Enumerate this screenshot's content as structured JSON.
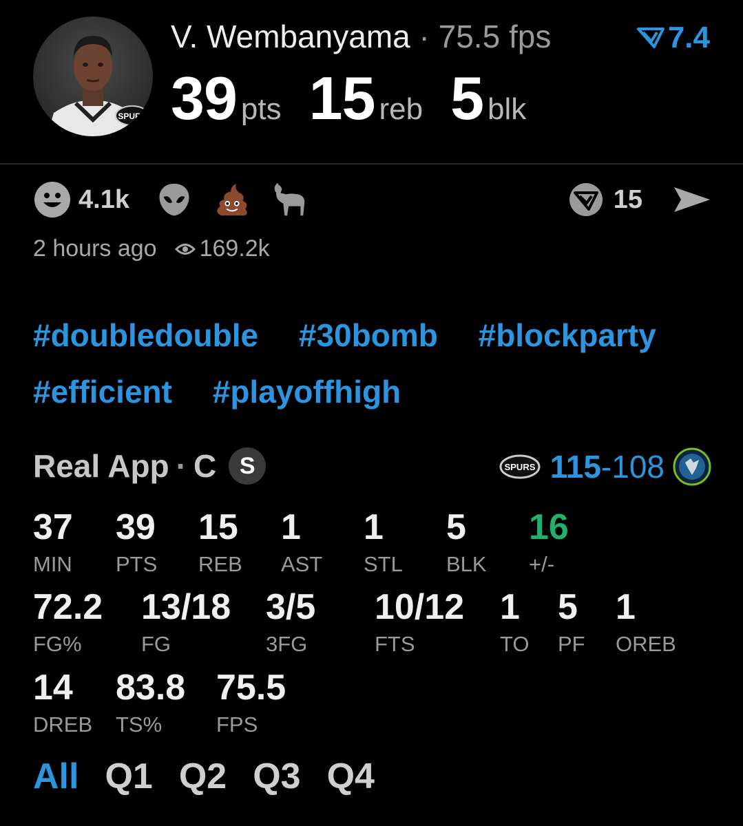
{
  "header": {
    "player_name": "V. Wembanyama",
    "separator": "·",
    "fps_text": "75.5 fps",
    "rating_value": "7.4",
    "stats": [
      {
        "value": "39",
        "unit": "pts"
      },
      {
        "value": "15",
        "unit": "reb"
      },
      {
        "value": "5",
        "unit": "blk"
      }
    ]
  },
  "reactions": {
    "smile_count": "4.1k",
    "icons": [
      "smile-icon",
      "alien-icon",
      "poop-icon",
      "goat-icon"
    ],
    "share_count": "15"
  },
  "meta": {
    "time_ago": "2 hours ago",
    "views": "169.2k"
  },
  "hashtags": [
    "#doubledouble",
    "#30bomb",
    "#blockparty",
    "#efficient",
    "#playoffhigh"
  ],
  "game": {
    "source": "Real App",
    "position": "C",
    "badge": "S",
    "score_home": "115",
    "score_dash": "-",
    "score_away": "108",
    "home_team_logo_text": "SPURS"
  },
  "box": [
    {
      "value": "37",
      "label": "MIN"
    },
    {
      "value": "39",
      "label": "PTS"
    },
    {
      "value": "15",
      "label": "REB"
    },
    {
      "value": "1",
      "label": "AST"
    },
    {
      "value": "1",
      "label": "STL"
    },
    {
      "value": "5",
      "label": "BLK"
    },
    {
      "value": "16",
      "label": "+/-"
    },
    {
      "value": "72.2",
      "label": "FG%"
    },
    {
      "value": "13/18",
      "label": "FG"
    },
    {
      "value": "3/5",
      "label": "3FG"
    },
    {
      "value": "10/12",
      "label": "FTS"
    },
    {
      "value": "1",
      "label": "TO"
    },
    {
      "value": "5",
      "label": "PF"
    },
    {
      "value": "1",
      "label": "OREB"
    },
    {
      "value": "14",
      "label": "DREB"
    },
    {
      "value": "83.8",
      "label": "TS%"
    },
    {
      "value": "75.5",
      "label": "FPS"
    }
  ],
  "periods": [
    "All",
    "Q1",
    "Q2",
    "Q3",
    "Q4"
  ],
  "colors": {
    "accent": "#2b95e0",
    "positive": "#20b26b",
    "background": "#000000"
  }
}
